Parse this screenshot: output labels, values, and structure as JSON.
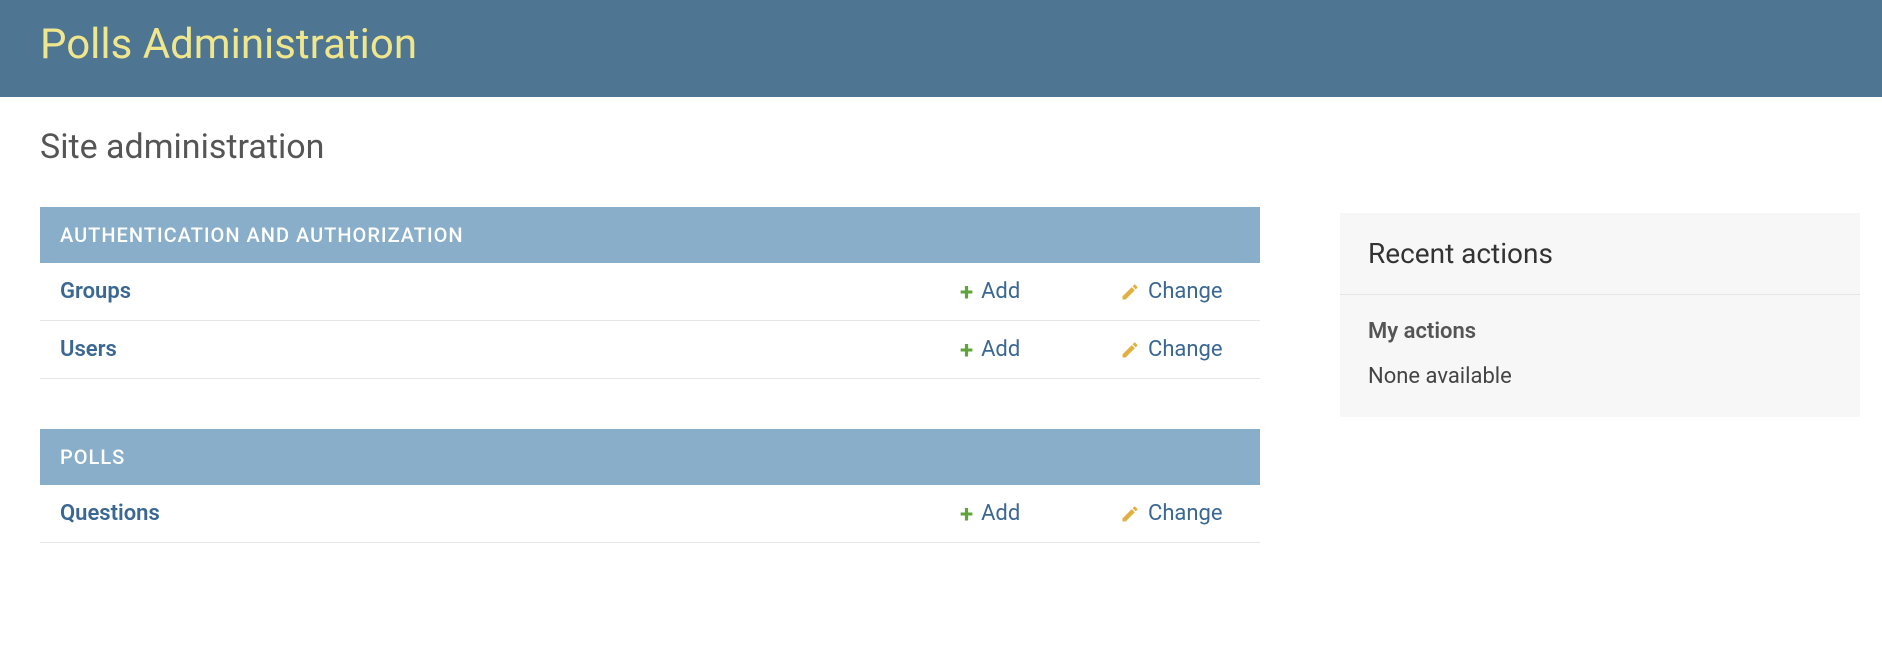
{
  "header": {
    "title": "Polls Administration"
  },
  "main": {
    "heading": "Site administration",
    "sections": [
      {
        "title": "AUTHENTICATION AND AUTHORIZATION",
        "models": [
          {
            "name": "Groups",
            "add": "Add",
            "change": "Change"
          },
          {
            "name": "Users",
            "add": "Add",
            "change": "Change"
          }
        ]
      },
      {
        "title": "POLLS",
        "models": [
          {
            "name": "Questions",
            "add": "Add",
            "change": "Change"
          }
        ]
      }
    ]
  },
  "sidebar": {
    "title": "Recent actions",
    "subtitle": "My actions",
    "empty": "None available"
  }
}
